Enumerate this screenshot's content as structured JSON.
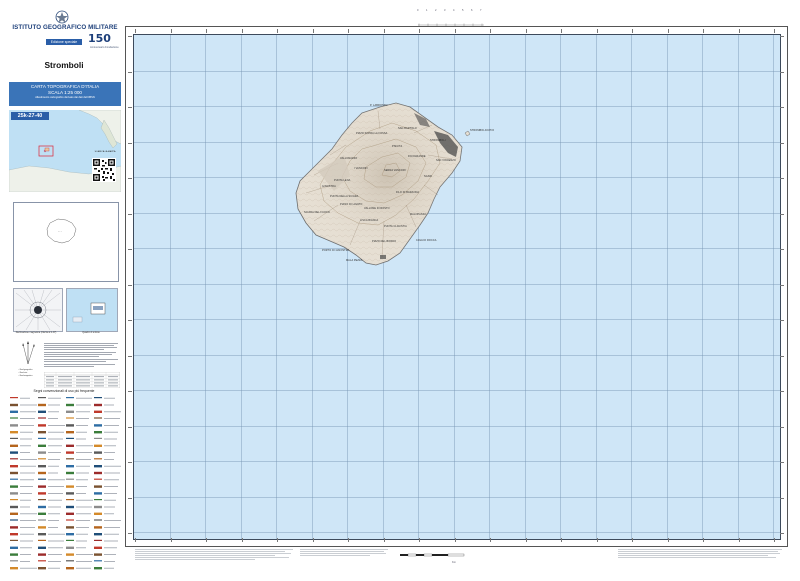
{
  "header": {
    "org_name": "ISTITUTO GEOGRAFICO MILITARE",
    "edition_label": "Edizione speciale",
    "anniversary": "150",
    "anniversary_sub": "Anniversario Fondazione"
  },
  "sheet": {
    "title": "Stromboli",
    "map_series": "CARTA TOPOGRAFICA D'ITALIA",
    "scale_text": "SCALA 1:25 000",
    "series_note": "Allestimento cartografico derivato dai dati del DBSN",
    "code": "25k-27-40"
  },
  "panels": {
    "qr_caption": "SCARICA LA MAPPA",
    "declination_caption": "Declinazione magnetica (riferita al 1-07)",
    "frame_caption": "Quadro di unione"
  },
  "legend": {
    "signs_title": "Segni convenzionali di uso più frequente"
  },
  "map": {
    "places": [
      "P. LABRONZO",
      "PIZZO SOPRA LA FOSSA",
      "SAN BARTOLO",
      "STROMBOLI",
      "PISCITA",
      "FICOGRANDE",
      "SAN VINCENZO",
      "VALLONAZZO",
      "I VANCORI",
      "SERRA VANCORI",
      "PUNTA LENA",
      "SCARI",
      "GINOSTRA",
      "PUNTA DELLA SCIARA",
      "FILO DI BARAONA",
      "PIANO DI LAVATO",
      "VALLONE DI ROSTO",
      "MALOPASSO",
      "LISCA BIANCA",
      "SCIARA DEL FUOCO",
      "PUNTA CLAVISTIA",
      "CAVA DI ROCCA",
      "PIZZO DEL BORDO",
      "PORTO DI GINOSTRA",
      "MALA PEZZA",
      "STROMBOLICCHIO"
    ],
    "scale_ruler": [
      "0",
      "1",
      "2",
      "3",
      "4",
      "5",
      "6",
      "7"
    ],
    "scale_bar_label": "Km"
  },
  "colors": {
    "sea": "#cfe6f7",
    "land": "#e6dfd3",
    "brand": "#1d3f7a",
    "title_box": "#3a74b8"
  }
}
